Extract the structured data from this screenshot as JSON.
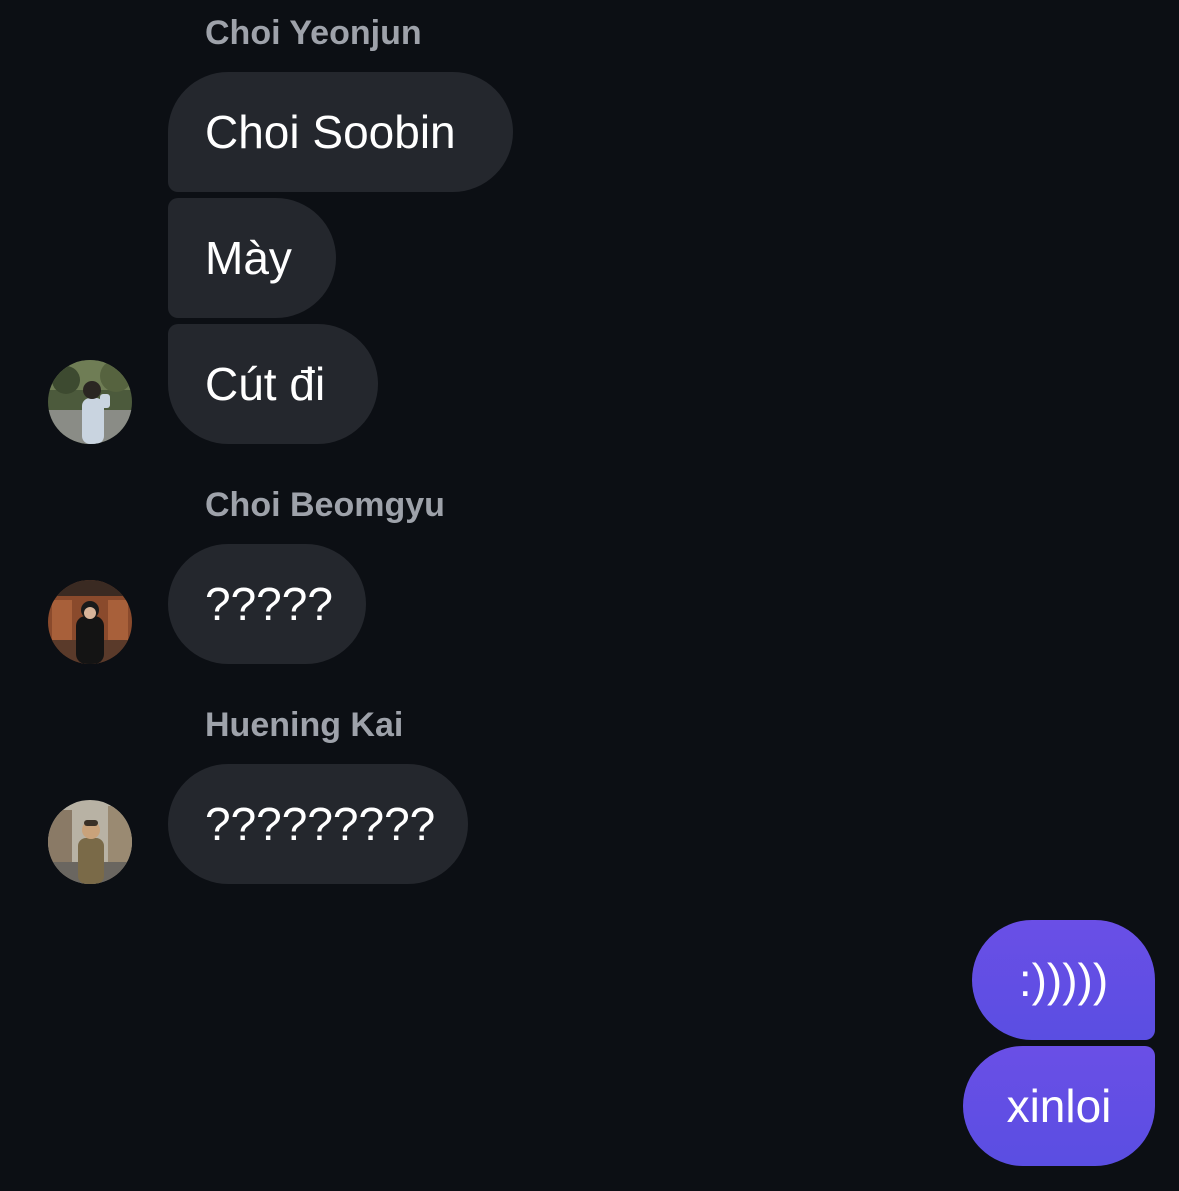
{
  "groups": [
    {
      "sender": "Choi Yeonjun",
      "messages": [
        "Choi Soobin",
        "Mày",
        "Cút đi"
      ],
      "avatar_icon": "avatar-photo-icon"
    },
    {
      "sender": "Choi Beomgyu",
      "messages": [
        "?????"
      ],
      "avatar_icon": "avatar-photo-icon"
    },
    {
      "sender": "Huening Kai",
      "messages": [
        "?????????"
      ],
      "avatar_icon": "avatar-photo-icon"
    }
  ],
  "outgoing": [
    ":)))))",
    "xinloi"
  ],
  "colors": {
    "background": "#0c0f14",
    "incoming_bubble": "#24272d",
    "outgoing_bubble": "#5b4fe3",
    "sender_name": "#9ea2aa",
    "text": "#ffffff"
  }
}
